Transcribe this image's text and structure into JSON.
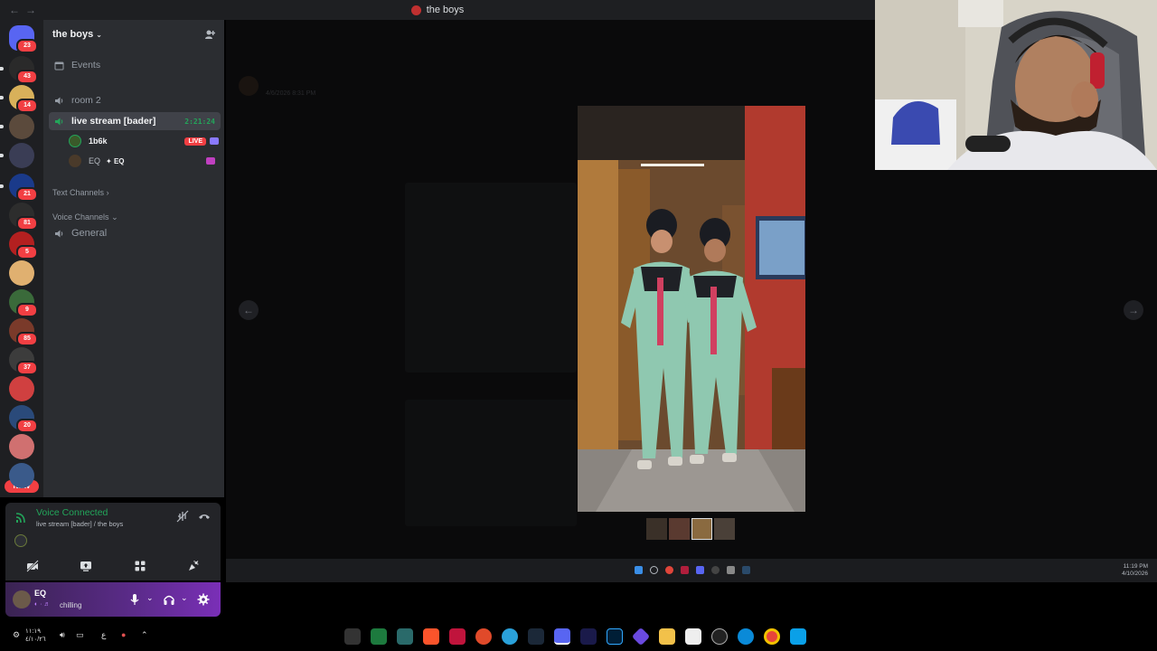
{
  "window": {
    "title": "the boys"
  },
  "server_rail": {
    "servers": [
      {
        "color": "#5865f2",
        "badge": "23"
      },
      {
        "color": "#2a2a2a",
        "badge": "43"
      },
      {
        "color": "#d8b15a",
        "badge": "14"
      },
      {
        "color": "#5b4a3c",
        "badge": ""
      },
      {
        "color": "#3a3d55",
        "badge": ""
      },
      {
        "color": "#1a3a8a",
        "badge": "21"
      },
      {
        "color": "#2d2d2d",
        "badge": "81"
      },
      {
        "color": "#b32020",
        "badge": "5"
      },
      {
        "color": "#e0b070",
        "badge": ""
      },
      {
        "color": "#3a6a3a",
        "badge": "9"
      },
      {
        "color": "#7a3a2a",
        "badge": "85"
      },
      {
        "color": "#3c3c3c",
        "badge": "37"
      },
      {
        "color": "#d04040",
        "badge": ""
      },
      {
        "color": "#2a4a7a",
        "badge": "20"
      },
      {
        "color": "#d07070",
        "badge": ""
      },
      {
        "color": "#3a5a8a",
        "badge": ""
      }
    ],
    "new_label": "NEW"
  },
  "sidebar": {
    "server_name": "the boys",
    "events_label": "Events",
    "room_label": "room 2",
    "active_channel": {
      "label": "live stream [bader]",
      "timer": "2:21:24"
    },
    "users": [
      {
        "name": "1b6k",
        "live": "LIVE",
        "avatar_color": "#3a5a2a"
      },
      {
        "name": "EQ",
        "tag": "EQ",
        "avatar_color": "#4a3a2a"
      }
    ],
    "text_channels_label": "Text Channels",
    "voice_channels_label": "Voice Channels",
    "general_label": "General"
  },
  "voice_panel": {
    "status": "Voice Connected",
    "location": "live stream [bader] / the boys"
  },
  "user_bar": {
    "name": "EQ",
    "status": "chilling",
    "accent": "#7a2fb7"
  },
  "viewer": {
    "timestamp": "4/6/2026 8:31 PM",
    "prev_icon": "arrow-left-icon",
    "next_icon": "arrow-right-icon"
  },
  "inner_taskbar": {
    "time": "11:19 PM",
    "date": "4/10/2026"
  },
  "system_taskbar": {
    "time": "١١:١٩",
    "date": "٤/١٠/٢٦"
  }
}
